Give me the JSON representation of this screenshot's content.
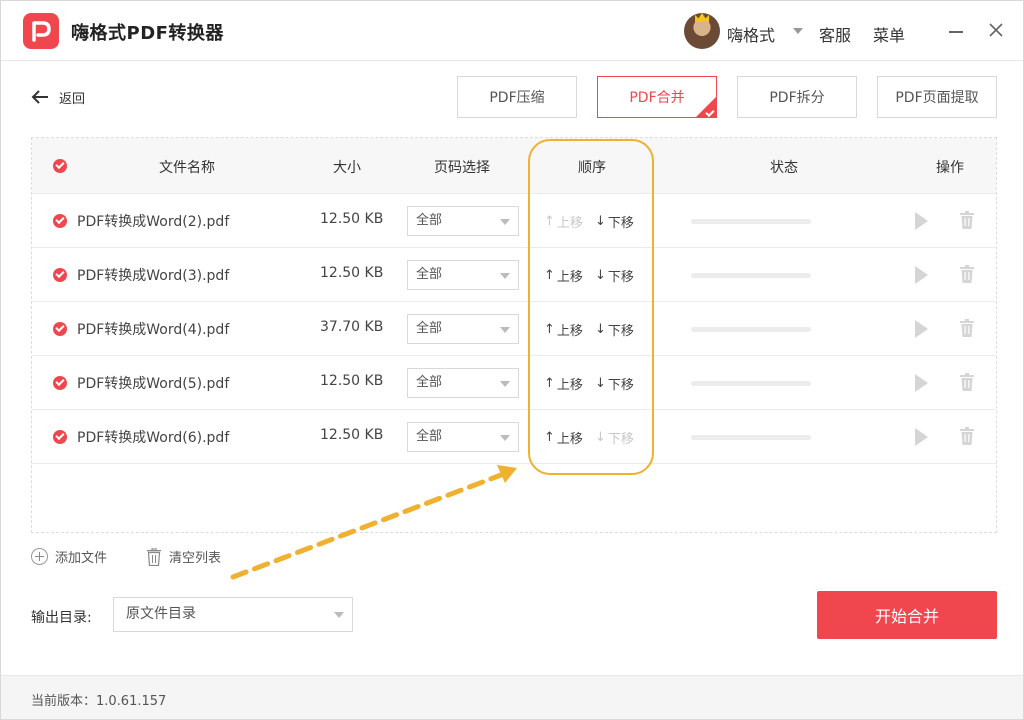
{
  "app": {
    "title": "嗨格式PDF转换器",
    "user_name": "嗨格式",
    "service": "客服",
    "menu": "菜单"
  },
  "nav": {
    "back_label": "返回"
  },
  "tabs": [
    {
      "label": "PDF压缩",
      "active": false
    },
    {
      "label": "PDF合并",
      "active": true
    },
    {
      "label": "PDF拆分",
      "active": false
    },
    {
      "label": "PDF页面提取",
      "active": false
    }
  ],
  "table": {
    "headers": {
      "name": "文件名称",
      "size": "大小",
      "pages": "页码选择",
      "order": "顺序",
      "status": "状态",
      "action": "操作"
    },
    "rows": [
      {
        "name": "PDF转换成Word(2).pdf",
        "size": "12.50 KB",
        "pages": "全部",
        "up": "上移",
        "down": "下移",
        "up_enabled": false,
        "down_enabled": true
      },
      {
        "name": "PDF转换成Word(3).pdf",
        "size": "12.50 KB",
        "pages": "全部",
        "up": "上移",
        "down": "下移",
        "up_enabled": true,
        "down_enabled": true
      },
      {
        "name": "PDF转换成Word(4).pdf",
        "size": "37.70 KB",
        "pages": "全部",
        "up": "上移",
        "down": "下移",
        "up_enabled": true,
        "down_enabled": true
      },
      {
        "name": "PDF转换成Word(5).pdf",
        "size": "12.50 KB",
        "pages": "全部",
        "up": "上移",
        "down": "下移",
        "up_enabled": true,
        "down_enabled": true
      },
      {
        "name": "PDF转换成Word(6).pdf",
        "size": "12.50 KB",
        "pages": "全部",
        "up": "上移",
        "down": "下移",
        "up_enabled": true,
        "down_enabled": false
      }
    ]
  },
  "tools": {
    "add_file": "添加文件",
    "clear_list": "清空列表"
  },
  "output": {
    "label": "输出目录:",
    "value": "原文件目录"
  },
  "start_button": "开始合并",
  "footer": {
    "version": "当前版本：1.0.61.157"
  },
  "colors": {
    "accent": "#f0474f",
    "highlight": "#f0b030"
  }
}
